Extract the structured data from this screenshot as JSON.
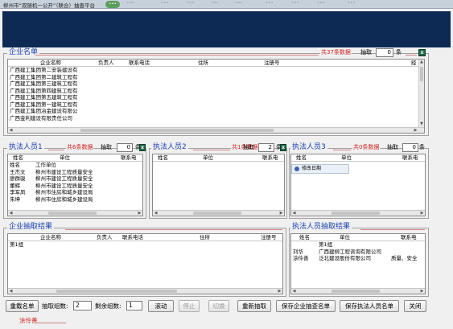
{
  "window": {
    "title": "柳州市“双随机一公开”（联合）抽查平台",
    "pill": "•••",
    "tabs": [
      "•••",
      "•••",
      "•••",
      "•••",
      "•••",
      "•••",
      "•••",
      "•••",
      "•••"
    ]
  },
  "colors": {
    "banner": "#0d2a55",
    "group_title": "#1a3fb0",
    "count": "#d02020"
  },
  "company_list": {
    "title": "企业名单",
    "count": "共37条数据",
    "pick_label": "抽取",
    "pick_value": "0",
    "unit": "条",
    "export_icon": "excel-icon",
    "columns": [
      "企业名称",
      "负责人",
      "联系电话",
      "住所",
      "注册号",
      "经"
    ],
    "rows": [
      "广西建工集团第二安装建设有",
      "广西建工集团第二建筑工程有",
      "广西建工集团第三建筑工程有",
      "广西建工集团第四建筑工程有",
      "广西建工集团第五建筑工程有",
      "广西建工集团第一建筑工程有",
      "广西建工集团冶金建设有限公",
      "广西金利建设有限责任公司"
    ]
  },
  "inspectors1": {
    "title": "执法人员1",
    "count": "共6条数据",
    "pick_label": "抽取",
    "pick_value": "0",
    "unit": "条",
    "columns": [
      "姓名",
      "单位",
      "联系电"
    ],
    "rows": [
      [
        "姓名",
        "工作单位"
      ],
      [
        "王杰文",
        "柳州市建设工程质量安全"
      ],
      [
        "廖群骏",
        "柳州市建设工程质量安全"
      ],
      [
        "董辉",
        "柳州市建设工程质量安全"
      ],
      [
        "李军凤",
        "柳州市住房和城乡建设局"
      ],
      [
        "朱坤",
        "柳州市住房和城乡建设局"
      ]
    ]
  },
  "inspectors2": {
    "title": "执法人员2",
    "count": "共1条数据",
    "pick_label": "抽取",
    "pick_value": "2",
    "unit": "条",
    "columns": [
      "姓名",
      "单位",
      "联系电"
    ]
  },
  "inspectors3": {
    "title": "执法人员3",
    "count": "共0条数据",
    "pick_label": "抽取",
    "pick_value": "0",
    "unit": "条",
    "columns": [
      "姓名",
      "单位",
      "联系电"
    ],
    "context_item": "修改日期"
  },
  "company_result": {
    "title": "企业抽取结果",
    "columns": [
      "企业名称",
      "负责人",
      "联系电话",
      "住所",
      "注册号"
    ],
    "rows": [
      "第1组"
    ]
  },
  "inspector_result": {
    "title": "执法人员抽取结果",
    "columns": [
      "姓名",
      "单位",
      "联系电"
    ],
    "rows": [
      [
        "",
        "第1组",
        ""
      ],
      [
        "刘华",
        "广西建柳工程咨询有限公司",
        ""
      ],
      [
        "涂伶善",
        "泛北建设股份有限公司",
        "质量、安全"
      ]
    ]
  },
  "bottom": {
    "reload": "重载名单",
    "groups_label": "抽取组数:",
    "groups_value": "2",
    "remaining_label": "剩余组数:",
    "remaining_value": "1",
    "scroll": "滚动",
    "stop": "停止",
    "switch": "切换",
    "redraw": "重新抽取",
    "save_company": "保存企业抽查名单",
    "save_inspector": "保存执法人员名单",
    "close": "关闭",
    "status": "涂伶善"
  }
}
